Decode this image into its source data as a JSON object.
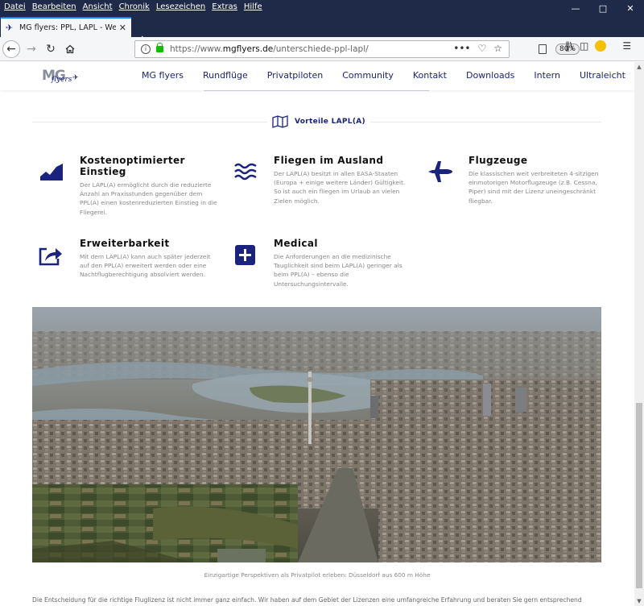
{
  "menubar": {
    "items": [
      "Datei",
      "Bearbeiten",
      "Ansicht",
      "Chronik",
      "Lesezeichen",
      "Extras",
      "Hilfe"
    ]
  },
  "tab": {
    "title": "MG flyers: PPL, LAPL - Welche Li"
  },
  "urlbar": {
    "prefix": "https://www.",
    "domain": "mgflyers.de",
    "path": "/unterschiede-ppl-lapl/",
    "zoom": "80%"
  },
  "site": {
    "logo_mg": "MG",
    "logo_flyers": "flyers",
    "nav": [
      "MG flyers",
      "Rundflüge",
      "Privatpiloten",
      "Community",
      "Kontakt",
      "Downloads",
      "Intern",
      "Ultraleicht"
    ]
  },
  "section": {
    "title": "Vorteile LAPL(A)"
  },
  "features": [
    {
      "title": "Kostenoptimierter Einstieg",
      "text": "Der LAPL(A) ermöglicht durch die reduzierte Anzahl an Praxisstunden gegenüber dem PPL(A) einen kostenreduzierten Einstieg in die Fliegerei.",
      "icon": "area-chart-icon"
    },
    {
      "title": "Fliegen im Ausland",
      "text": "Der LAPL(A) besitzt in allen EASA-Staaten (Europa + einige weitere Länder) Gültigkeit. So ist auch ein fliegen im Urlaub an vielen Zielen möglich.",
      "icon": "waves-icon"
    },
    {
      "title": "Flugzeuge",
      "text": "Die klassischen weit verbreiteten 4-sitzigen einmotorigen Motorflugzeuge (z.B. Cessna, Piper) sind mit der Lizenz uneingeschränkt fliegbar.",
      "icon": "plane-icon"
    },
    {
      "title": "Erweiterbarkeit",
      "text": "Mit dem LAPL(A) kann auch später jederzeit auf den PPL(A) erweitert werden oder eine Nachtflugberechtigung absolviert werden.",
      "icon": "share-icon"
    },
    {
      "title": "Medical",
      "text": "Die Anforderungen an die medizinische Tauglichkeit sind beim LAPL(A) geringer als beim PPL(A) – ebenso die Untersuchungsintervalle.",
      "icon": "plus-square-icon"
    }
  ],
  "photo": {
    "caption": "Einzigartige Perspektiven als Privatpilot erleben: Düsseldorf aus 600 m Höhe"
  },
  "body": {
    "intro": "Die Entscheidung für die richtige Fluglizenz ist nicht immer ganz einfach. Wir haben auf dem Gebiet der Lizenzen eine umfangreiche Erfahrung und beraten Sie gern entsprechend"
  },
  "colors": {
    "brand": "#1a237e",
    "chrome": "#1f2a48",
    "text_muted": "#888888"
  }
}
